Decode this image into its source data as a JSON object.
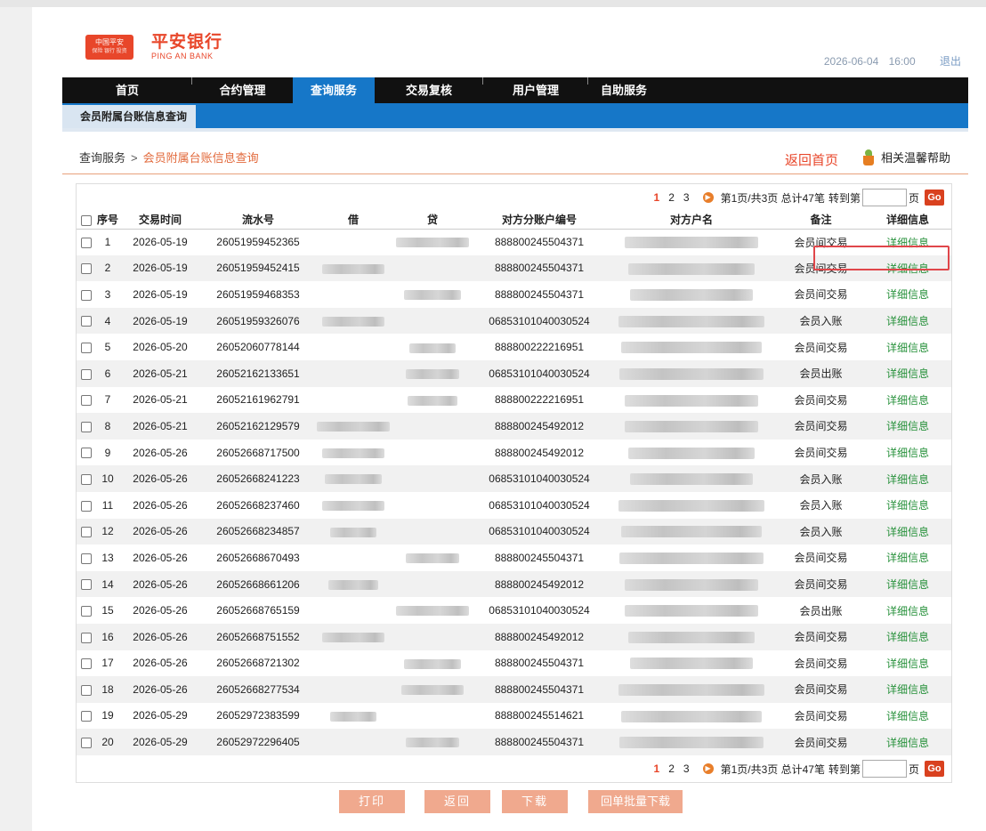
{
  "header": {
    "logo_badge_cn": "中国平安",
    "logo_badge_sub": "保险 银行 投资",
    "brand_cn": "平安银行",
    "brand_en": "PING AN BANK",
    "date": "2026-06-04",
    "time": "16:00",
    "logout": "退出"
  },
  "nav": {
    "items": [
      "首页",
      "合约管理",
      "查询服务",
      "交易复核",
      "用户管理",
      "自助服务"
    ],
    "active": "查询服务",
    "subtab": "会员附属台账信息查询"
  },
  "breadcrumb": {
    "parent": "查询服务",
    "separator": ">",
    "current": "会员附属台账信息查询",
    "back_home": "返回首页",
    "help": "相关温馨帮助"
  },
  "pager": {
    "pages": [
      "1",
      "2",
      "3"
    ],
    "current": "1",
    "summary": "第1页/共3页 总计47笔",
    "goto_label": "转到第",
    "page_suffix": "页",
    "go_label": "Go",
    "next_icon": "play-icon"
  },
  "table": {
    "headers": [
      "序号",
      "交易时间",
      "流水号",
      "借",
      "贷",
      "对方分账户编号",
      "对方户名",
      "备注",
      "详细信息"
    ],
    "rows": [
      {
        "no": "1",
        "date": "2026-05-19",
        "serial": "26051959452365",
        "account": "888800245504371",
        "memo": "会员间交易",
        "detail": "详细信息"
      },
      {
        "no": "2",
        "date": "2026-05-19",
        "serial": "26051959452415",
        "account": "888800245504371",
        "memo": "会员间交易",
        "detail": "详细信息"
      },
      {
        "no": "3",
        "date": "2026-05-19",
        "serial": "26051959468353",
        "account": "888800245504371",
        "memo": "会员间交易",
        "detail": "详细信息"
      },
      {
        "no": "4",
        "date": "2026-05-19",
        "serial": "26051959326076",
        "account": "06853101040030524",
        "memo": "会员入账",
        "detail": "详细信息"
      },
      {
        "no": "5",
        "date": "2026-05-20",
        "serial": "26052060778144",
        "account": "888800222216951",
        "memo": "会员间交易",
        "detail": "详细信息"
      },
      {
        "no": "6",
        "date": "2026-05-21",
        "serial": "26052162133651",
        "account": "06853101040030524",
        "memo": "会员出账",
        "detail": "详细信息"
      },
      {
        "no": "7",
        "date": "2026-05-21",
        "serial": "26052161962791",
        "account": "888800222216951",
        "memo": "会员间交易",
        "detail": "详细信息"
      },
      {
        "no": "8",
        "date": "2026-05-21",
        "serial": "26052162129579",
        "account": "888800245492012",
        "memo": "会员间交易",
        "detail": "详细信息"
      },
      {
        "no": "9",
        "date": "2026-05-26",
        "serial": "26052668717500",
        "account": "888800245492012",
        "memo": "会员间交易",
        "detail": "详细信息"
      },
      {
        "no": "10",
        "date": "2026-05-26",
        "serial": "26052668241223",
        "account": "06853101040030524",
        "memo": "会员入账",
        "detail": "详细信息"
      },
      {
        "no": "11",
        "date": "2026-05-26",
        "serial": "26052668237460",
        "account": "06853101040030524",
        "memo": "会员入账",
        "detail": "详细信息"
      },
      {
        "no": "12",
        "date": "2026-05-26",
        "serial": "26052668234857",
        "account": "06853101040030524",
        "memo": "会员入账",
        "detail": "详细信息"
      },
      {
        "no": "13",
        "date": "2026-05-26",
        "serial": "26052668670493",
        "account": "888800245504371",
        "memo": "会员间交易",
        "detail": "详细信息"
      },
      {
        "no": "14",
        "date": "2026-05-26",
        "serial": "26052668661206",
        "account": "888800245492012",
        "memo": "会员间交易",
        "detail": "详细信息"
      },
      {
        "no": "15",
        "date": "2026-05-26",
        "serial": "26052668765159",
        "account": "06853101040030524",
        "memo": "会员出账",
        "detail": "详细信息"
      },
      {
        "no": "16",
        "date": "2026-05-26",
        "serial": "26052668751552",
        "account": "888800245492012",
        "memo": "会员间交易",
        "detail": "详细信息"
      },
      {
        "no": "17",
        "date": "2026-05-26",
        "serial": "26052668721302",
        "account": "888800245504371",
        "memo": "会员间交易",
        "detail": "详细信息"
      },
      {
        "no": "18",
        "date": "2026-05-26",
        "serial": "26052668277534",
        "account": "888800245504371",
        "memo": "会员间交易",
        "detail": "详细信息"
      },
      {
        "no": "19",
        "date": "2026-05-29",
        "serial": "26052972383599",
        "account": "888800245514621",
        "memo": "会员间交易",
        "detail": "详细信息"
      },
      {
        "no": "20",
        "date": "2026-05-29",
        "serial": "26052972296405",
        "account": "888800245504371",
        "memo": "会员间交易",
        "detail": "详细信息"
      }
    ]
  },
  "buttons": {
    "print": "打印",
    "back": "返回",
    "download": "下载",
    "batch_download": "回单批量下载"
  },
  "colors": {
    "brand": "#e8462a",
    "nav_active": "#1677c8",
    "link_green": "#27913b",
    "button": "#f0a98e",
    "highlight": "#e0464a"
  }
}
